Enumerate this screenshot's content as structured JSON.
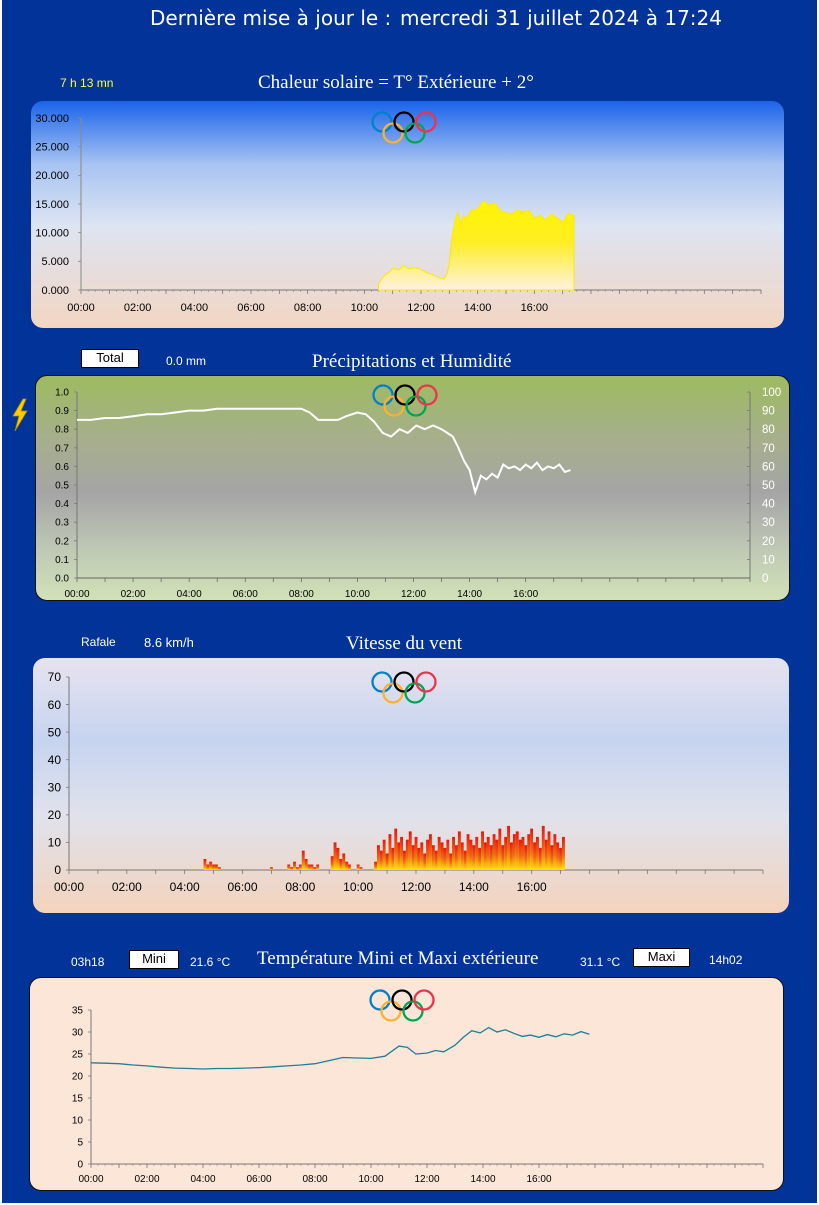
{
  "header": {
    "update_label": "Dernière mise à jour le :",
    "update_datetime": "mercredi 31 juillet 2024 à 17:24"
  },
  "solar": {
    "duration": "7 h 13 mn",
    "title": "Chaleur solaire = T° Extérieure + 2°"
  },
  "rain": {
    "total_label": "Total",
    "total_value": "0.0 mm",
    "title": "Précipitations et Humidité"
  },
  "wind": {
    "gust_label": "Rafale",
    "gust_value": "8.6 km/h",
    "title": "Vitesse du vent"
  },
  "temp": {
    "min_time": "03h18",
    "min_label": "Mini",
    "min_value": "21.6 °C",
    "title": "Température Mini et Maxi extérieure",
    "max_value": "31.1 °C",
    "max_label": "Maxi",
    "max_time": "14h02"
  },
  "colors": {
    "background": "#023399",
    "solar_fill": "#ffee00",
    "humidity_line": "#ffffff",
    "wind_fill_top": "#e8180c",
    "wind_fill_bottom": "#ffe600",
    "temperature_line": "#1f7f9a",
    "olympic_blue": "#0081c8",
    "olympic_yellow": "#fcb131",
    "olympic_black": "#000000",
    "olympic_green": "#00a651",
    "olympic_red": "#ee334e"
  },
  "chart_data": [
    {
      "type": "area",
      "title": "Chaleur solaire = T° Extérieure + 2°",
      "x_ticks": [
        "00:00",
        "02:00",
        "04:00",
        "06:00",
        "08:00",
        "10:00",
        "12:00",
        "14:00",
        "16:00"
      ],
      "y_ticks": [
        "0.000",
        "5.000",
        "10.000",
        "15.000",
        "20.000",
        "25.000",
        "30.000"
      ],
      "ylim": [
        0,
        30000
      ],
      "xlim": [
        0,
        24
      ],
      "series": [
        {
          "x": [
            10.5,
            10.7,
            10.9,
            11.0,
            11.2,
            11.4,
            11.6,
            11.8,
            12.0,
            12.2,
            12.4,
            12.6,
            12.8,
            12.9,
            13.0,
            13.1,
            13.2,
            13.3,
            13.4,
            13.5,
            13.6,
            13.8,
            14.0,
            14.2,
            14.4,
            14.6,
            14.8,
            15.0,
            15.2,
            15.4,
            15.6,
            15.8,
            16.0,
            16.2,
            16.4,
            16.6,
            16.8,
            17.0,
            17.2,
            17.3,
            17.4
          ],
          "y": [
            1000,
            2500,
            3200,
            3800,
            3500,
            4200,
            3700,
            3900,
            3600,
            3000,
            2700,
            2200,
            1900,
            2500,
            4500,
            9500,
            12000,
            13500,
            11500,
            13000,
            12500,
            14000,
            14200,
            15500,
            14800,
            15200,
            13800,
            13500,
            13200,
            14000,
            13600,
            13900,
            12500,
            13000,
            12200,
            13300,
            12600,
            11800,
            13400,
            13200,
            13000
          ]
        }
      ]
    },
    {
      "type": "line",
      "title": "Précipitations et Humidité",
      "x_ticks": [
        "00:00",
        "02:00",
        "04:00",
        "06:00",
        "08:00",
        "10:00",
        "12:00",
        "14:00",
        "16:00"
      ],
      "y_ticks_left": [
        "0.0",
        "0.1",
        "0.2",
        "0.3",
        "0.4",
        "0.5",
        "0.6",
        "0.7",
        "0.8",
        "0.9",
        "1.0"
      ],
      "y_ticks_right": [
        "0",
        "10",
        "20",
        "30",
        "40",
        "50",
        "60",
        "70",
        "80",
        "90",
        "100"
      ],
      "ylim_left": [
        0,
        1
      ],
      "ylim_right": [
        0,
        100
      ],
      "xlim": [
        0,
        24
      ],
      "series": [
        {
          "name": "",
          "x": [
            0,
            0.5,
            1,
            1.5,
            2,
            2.5,
            3,
            3.5,
            4,
            4.5,
            5,
            5.5,
            6,
            6.5,
            7,
            7.5,
            8,
            8.3,
            8.6,
            9,
            9.3,
            9.6,
            10,
            10.3,
            10.6,
            10.9,
            11.2,
            11.5,
            11.8,
            12.1,
            12.4,
            12.7,
            13.0,
            13.2,
            13.4,
            13.6,
            13.8,
            14.0,
            14.2,
            14.4,
            14.6,
            14.8,
            15.0,
            15.2,
            15.4,
            15.6,
            15.8,
            16.0,
            16.2,
            16.4,
            16.6,
            16.8,
            17.0,
            17.2,
            17.4,
            17.6
          ],
          "y": [
            85,
            85,
            86,
            86,
            87,
            88,
            88,
            89,
            90,
            90,
            91,
            91,
            91,
            91,
            91,
            91,
            91,
            89,
            85,
            85,
            85,
            87,
            89,
            88,
            84,
            78,
            76,
            80,
            78,
            82,
            80,
            82,
            80,
            78,
            76,
            70,
            63,
            58,
            46,
            55,
            53,
            56,
            54,
            61,
            59,
            60,
            58,
            61,
            59,
            62,
            58,
            60,
            59,
            61,
            57,
            58
          ]
        }
      ]
    },
    {
      "type": "bar",
      "title": "Vitesse du vent",
      "x_ticks": [
        "00:00",
        "02:00",
        "04:00",
        "06:00",
        "08:00",
        "10:00",
        "12:00",
        "14:00",
        "16:00"
      ],
      "y_ticks": [
        "0",
        "10",
        "20",
        "30",
        "40",
        "50",
        "60",
        "70"
      ],
      "ylim": [
        0,
        70
      ],
      "xlim": [
        0,
        24
      ],
      "series": [
        {
          "x_range": [
            4.7,
            17.1
          ],
          "x": [
            4.7,
            4.8,
            4.9,
            5.0,
            5.1,
            5.2,
            7.0,
            7.6,
            7.7,
            7.8,
            7.9,
            8.0,
            8.1,
            8.2,
            8.3,
            8.4,
            8.5,
            8.6,
            9.1,
            9.2,
            9.3,
            9.4,
            9.5,
            9.6,
            9.7,
            10.0,
            10.1,
            10.6,
            10.7,
            10.8,
            10.9,
            11.0,
            11.1,
            11.2,
            11.3,
            11.4,
            11.5,
            11.6,
            11.7,
            11.8,
            11.9,
            12.0,
            12.1,
            12.2,
            12.3,
            12.4,
            12.5,
            12.6,
            12.7,
            12.8,
            12.9,
            13.0,
            13.1,
            13.2,
            13.3,
            13.4,
            13.5,
            13.6,
            13.7,
            13.8,
            13.9,
            14.0,
            14.1,
            14.2,
            14.3,
            14.4,
            14.5,
            14.6,
            14.7,
            14.8,
            14.9,
            15.0,
            15.1,
            15.2,
            15.3,
            15.4,
            15.5,
            15.6,
            15.7,
            15.8,
            15.9,
            16.0,
            16.1,
            16.2,
            16.3,
            16.4,
            16.5,
            16.6,
            16.7,
            16.8,
            16.9,
            17.0,
            17.1
          ],
          "y": [
            4,
            2,
            3,
            2,
            2,
            1,
            1,
            2,
            1,
            3,
            1,
            2,
            7,
            4,
            2,
            2,
            1,
            2,
            5,
            10,
            8,
            4,
            6,
            3,
            2,
            2,
            1,
            3,
            9,
            7,
            11,
            6,
            13,
            8,
            15,
            10,
            12,
            7,
            11,
            14,
            9,
            12,
            8,
            10,
            6,
            11,
            13,
            9,
            7,
            12,
            10,
            8,
            11,
            6,
            12,
            9,
            14,
            10,
            7,
            13,
            11,
            9,
            12,
            8,
            14,
            10,
            12,
            9,
            13,
            11,
            15,
            9,
            12,
            16,
            10,
            13,
            14,
            11,
            12,
            9,
            13,
            15,
            10,
            12,
            8,
            16,
            11,
            14,
            9,
            13,
            10,
            8,
            12
          ]
        }
      ]
    },
    {
      "type": "line",
      "title": "Température Mini et Maxi extérieure",
      "x_ticks": [
        "00:00",
        "02:00",
        "04:00",
        "06:00",
        "08:00",
        "10:00",
        "12:00",
        "14:00",
        "16:00"
      ],
      "y_ticks": [
        "0",
        "5",
        "10",
        "15",
        "20",
        "25",
        "30",
        "35"
      ],
      "ylim": [
        0,
        35
      ],
      "xlim": [
        0,
        24
      ],
      "series": [
        {
          "x": [
            0,
            0.5,
            1,
            1.5,
            2,
            2.5,
            3,
            3.5,
            4,
            4.5,
            5,
            5.5,
            6,
            6.5,
            7,
            7.5,
            8,
            8.5,
            9,
            9.5,
            10,
            10.5,
            11,
            11.3,
            11.6,
            12,
            12.3,
            12.6,
            13,
            13.3,
            13.6,
            13.9,
            14.2,
            14.5,
            14.8,
            15.1,
            15.4,
            15.7,
            16.0,
            16.3,
            16.6,
            16.9,
            17.2,
            17.5,
            17.8
          ],
          "y": [
            23.0,
            22.9,
            22.8,
            22.5,
            22.3,
            22.0,
            21.8,
            21.7,
            21.6,
            21.7,
            21.7,
            21.8,
            21.9,
            22.1,
            22.3,
            22.5,
            22.8,
            23.5,
            24.2,
            24.1,
            24.0,
            24.5,
            26.8,
            26.5,
            25.0,
            25.2,
            25.8,
            25.5,
            27.0,
            28.8,
            30.3,
            29.8,
            31.0,
            30.0,
            30.5,
            29.7,
            29.0,
            29.3,
            28.8,
            29.4,
            28.9,
            29.6,
            29.3,
            30.1,
            29.5
          ]
        }
      ]
    }
  ]
}
